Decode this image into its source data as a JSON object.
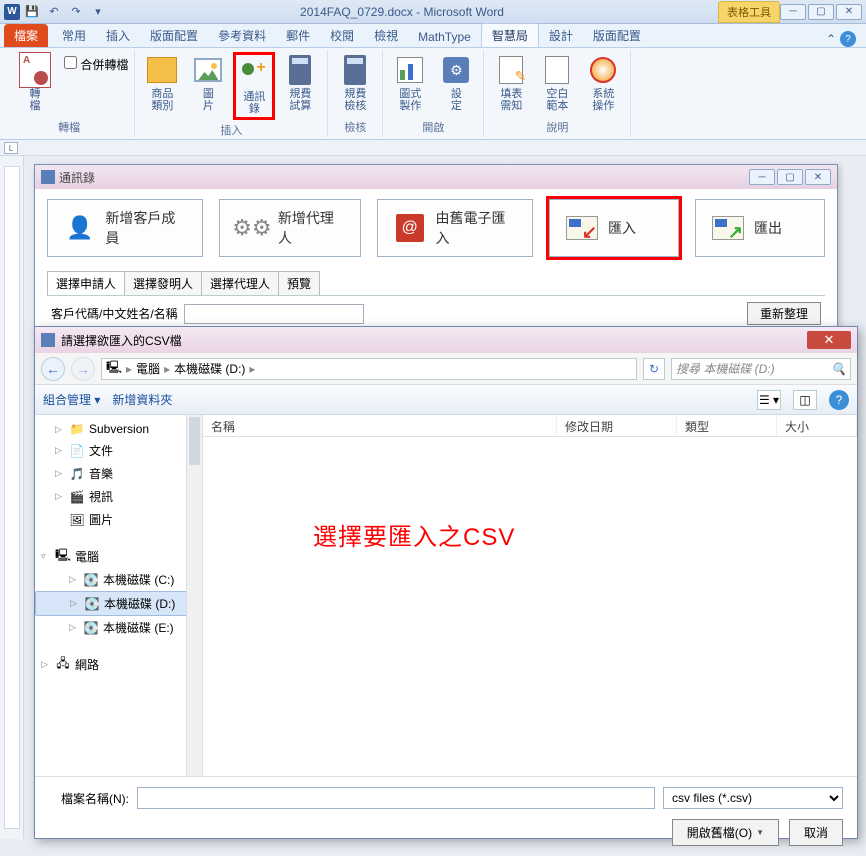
{
  "word": {
    "title": "2014FAQ_0729.docx - Microsoft Word",
    "context_tab": "表格工具",
    "file_tab": "檔案",
    "tabs": [
      "常用",
      "插入",
      "版面配置",
      "參考資料",
      "郵件",
      "校閱",
      "檢視",
      "MathType",
      "智慧局",
      "設計",
      "版面配置"
    ],
    "active_tab_index": 8
  },
  "ribbon": {
    "convert": {
      "merge_convert": "合併轉檔",
      "convert": "轉\n檔",
      "group": "轉檔"
    },
    "insert": {
      "items": [
        "商品\n類別",
        "圖\n片",
        "通訊\n錄",
        "規費\n試算"
      ],
      "group": "插入"
    },
    "review": {
      "items": [
        "規費\n檢核"
      ],
      "group": "檢核"
    },
    "open": {
      "items": [
        "圖式\n製作",
        "設\n定"
      ],
      "group": "開啟"
    },
    "help": {
      "items": [
        "填表\n需知",
        "空白\n範本",
        "系統\n操作"
      ],
      "group": "說明"
    }
  },
  "contacts": {
    "title": "通訊錄",
    "buttons": {
      "new_member": "新增客戶成員",
      "new_agent": "新增代理人",
      "import_old": "由舊電子匯入",
      "import": "匯入",
      "export": "匯出"
    },
    "sub_tabs": [
      "選擇申請人",
      "選擇發明人",
      "選擇代理人",
      "預覽"
    ],
    "label_code": "客戶代碼/中文姓名/名稱",
    "refresh": "重新整理"
  },
  "filedlg": {
    "title": "請選擇欲匯入的CSV檔",
    "crumbs": [
      "電腦",
      "本機磁碟 (D:)"
    ],
    "search_placeholder": "搜尋 本機磁碟 (D:)",
    "organize": "組合管理",
    "new_folder": "新增資料夾",
    "columns": {
      "name": "名稱",
      "date": "修改日期",
      "type": "類型",
      "size": "大小"
    },
    "tree": {
      "subversion": "Subversion",
      "documents": "文件",
      "music": "音樂",
      "videos": "視訊",
      "pictures": "圖片",
      "computer": "電腦",
      "drive_c": "本機磁碟 (C:)",
      "drive_d": "本機磁碟 (D:)",
      "drive_e": "本機磁碟 (E:)",
      "network": "網路"
    },
    "overlay": "選擇要匯入之CSV",
    "filename_label": "檔案名稱(N):",
    "filter": "csv files (*.csv)",
    "open": "開啟舊檔(O)",
    "cancel": "取消"
  }
}
